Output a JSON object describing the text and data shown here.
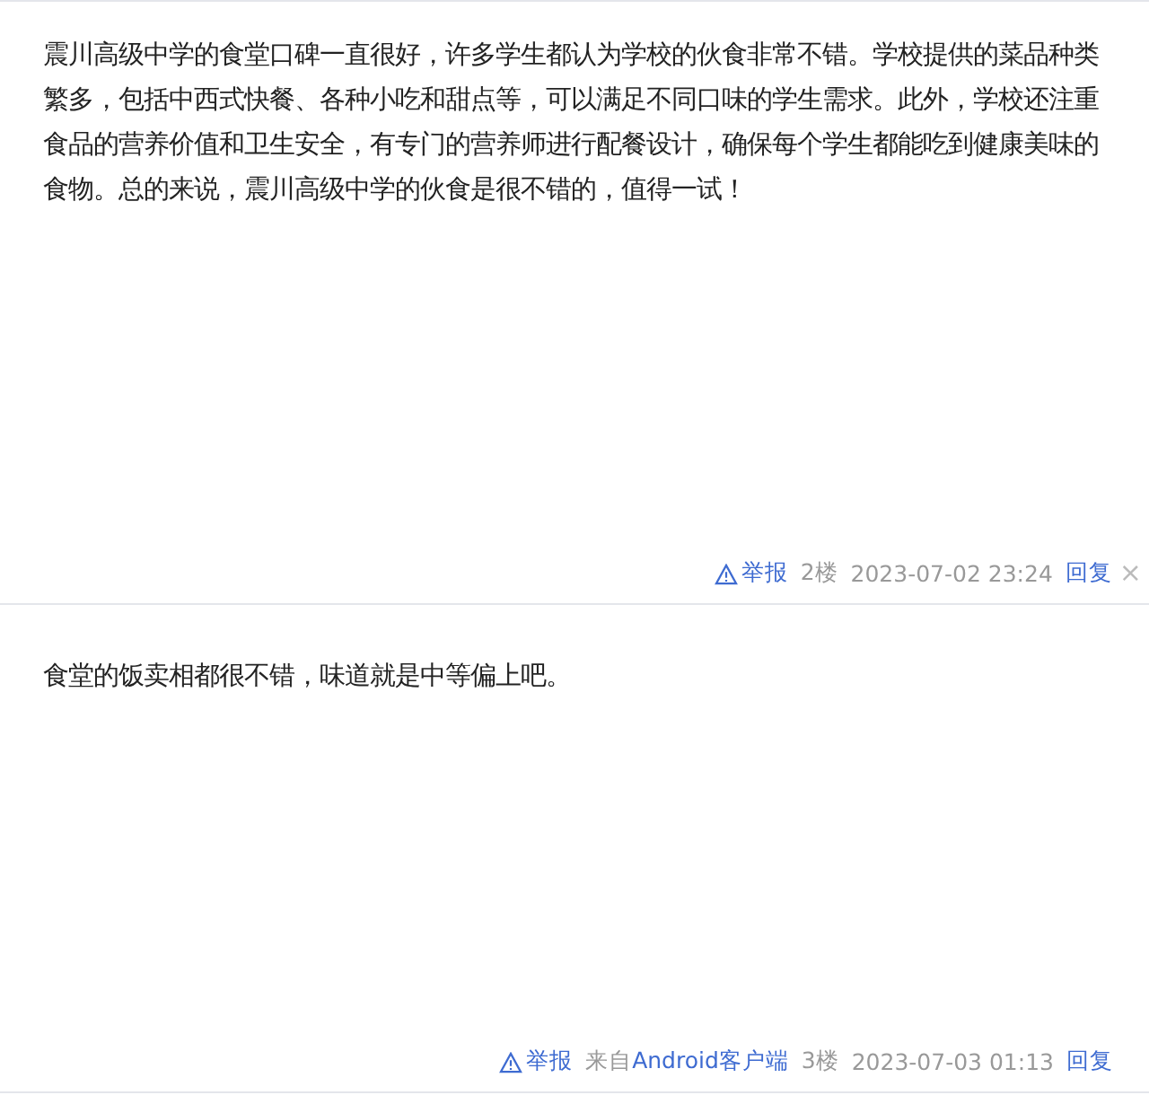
{
  "posts": [
    {
      "content": "震川高级中学的食堂口碑一直很好，许多学生都认为学校的伙食非常不错。学校提供的菜品种类繁多，包括中西式快餐、各种小吃和甜点等，可以满足不同口味的学生需求。此外，学校还注重食品的营养价值和卫生安全，有专门的营养师进行配餐设计，确保每个学生都能吃到健康美味的食物。总的来说，震川高级中学的伙食是很不错的，值得一试！",
      "report": "举报",
      "floor": "2楼",
      "time": "2023-07-02 23:24",
      "reply": "回复",
      "close": "×"
    },
    {
      "content": "食堂的饭卖相都很不错，味道就是中等偏上吧。",
      "report": "举报",
      "source_prefix": "来自",
      "source_link": "Android客户端",
      "floor": "3楼",
      "time": "2023-07-03 01:13",
      "reply": "回复"
    }
  ]
}
